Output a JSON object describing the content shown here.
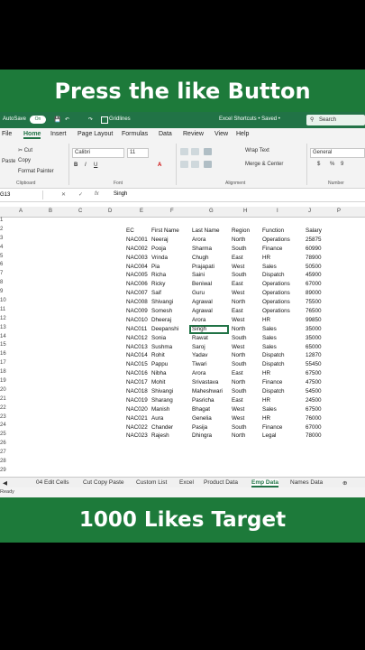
{
  "banners": {
    "top": "Press the like Button",
    "bottom": "1000 Likes Target"
  },
  "titlebar": {
    "autosave": "AutoSave",
    "toggle": "On",
    "gridlines": "Gridlines",
    "filename": "Excel Shortcuts • Saved •",
    "search": "Search"
  },
  "menu": [
    "File",
    "Home",
    "Insert",
    "Page Layout",
    "Formulas",
    "Data",
    "Review",
    "View",
    "Help"
  ],
  "ribbon": {
    "cut": "Cut",
    "copy": "Copy",
    "format_painter": "Format Painter",
    "paste": "Paste",
    "clipboard": "Clipboard",
    "font_name": "Calibri",
    "font_size": "11",
    "font": "Font",
    "wrap_text": "Wrap Text",
    "merge_center": "Merge & Center",
    "alignment": "Alignment",
    "number_format": "General",
    "number": "Number"
  },
  "formula_bar": {
    "name_box": "G13",
    "fx": "fx",
    "value": "Singh"
  },
  "columns": [
    "A",
    "B",
    "C",
    "D",
    "E",
    "F",
    "G",
    "H",
    "I",
    "J",
    "P"
  ],
  "row_numbers": [
    "1",
    "2",
    "3",
    "4",
    "5",
    "6",
    "7",
    "8",
    "9",
    "10",
    "11",
    "12",
    "13",
    "14",
    "15",
    "16",
    "17",
    "18",
    "19",
    "20",
    "21",
    "22",
    "23",
    "24",
    "25",
    "26",
    "27",
    "28",
    "29"
  ],
  "table": {
    "headers": [
      "EC",
      "First Name",
      "Last Name",
      "Region",
      "Function",
      "Salary"
    ],
    "rows": [
      [
        "NAC001",
        "Neeraj",
        "Arora",
        "North",
        "Operations",
        "25875"
      ],
      [
        "NAC002",
        "Pooja",
        "Sharma",
        "South",
        "Finance",
        "60990"
      ],
      [
        "NAC003",
        "Vrinda",
        "Chugh",
        "East",
        "HR",
        "78900"
      ],
      [
        "NAC004",
        "Pia",
        "Prajapati",
        "West",
        "Sales",
        "50500"
      ],
      [
        "NAC005",
        "Richa",
        "Saini",
        "South",
        "Dispatch",
        "45900"
      ],
      [
        "NAC006",
        "Ricky",
        "Beniwal",
        "East",
        "Operations",
        "67000"
      ],
      [
        "NAC007",
        "Saif",
        "Guru",
        "West",
        "Operations",
        "89000"
      ],
      [
        "NAC008",
        "Shivangi",
        "Agrawal",
        "North",
        "Operations",
        "75500"
      ],
      [
        "NAC009",
        "Somesh",
        "Agrawal",
        "East",
        "Operations",
        "76500"
      ],
      [
        "NAC010",
        "Dheeraj",
        "Arora",
        "West",
        "HR",
        "99850"
      ],
      [
        "NAC011",
        "Deepanshi",
        "Singh",
        "North",
        "Sales",
        "35000"
      ],
      [
        "NAC012",
        "Sonia",
        "Rawat",
        "South",
        "Sales",
        "35000"
      ],
      [
        "NAC013",
        "Sushma",
        "Saroj",
        "West",
        "Sales",
        "65000"
      ],
      [
        "NAC014",
        "Rohit",
        "Yadav",
        "North",
        "Dispatch",
        "12870"
      ],
      [
        "NAC015",
        "Pappu",
        "Tiwari",
        "South",
        "Dispatch",
        "55450"
      ],
      [
        "NAC016",
        "Nibha",
        "Arora",
        "East",
        "HR",
        "67500"
      ],
      [
        "NAC017",
        "Mohit",
        "Srivastava",
        "North",
        "Finance",
        "47500"
      ],
      [
        "NAC018",
        "Shivangi",
        "Maheshwari",
        "South",
        "Dispatch",
        "54500"
      ],
      [
        "NAC019",
        "Sharang",
        "Pasricha",
        "East",
        "HR",
        "24500"
      ],
      [
        "NAC020",
        "Manish",
        "Bhagat",
        "West",
        "Sales",
        "67500"
      ],
      [
        "NAC021",
        "Aura",
        "Genelia",
        "West",
        "HR",
        "76000"
      ],
      [
        "NAC022",
        "Chander",
        "Pasija",
        "South",
        "Finance",
        "67000"
      ],
      [
        "NAC023",
        "Rajesh",
        "Dhingra",
        "North",
        "Legal",
        "78000"
      ]
    ]
  },
  "sheet_tabs": [
    "04 Edit Cells",
    "Cut Copy Paste",
    "Custom List",
    "Excel",
    "Product Data",
    "Emp Data",
    "Names Data"
  ],
  "active_sheet": "Emp Data",
  "status": "Ready",
  "colors": {
    "excel_green": "#217346",
    "banner_green": "#1d7a3a"
  }
}
